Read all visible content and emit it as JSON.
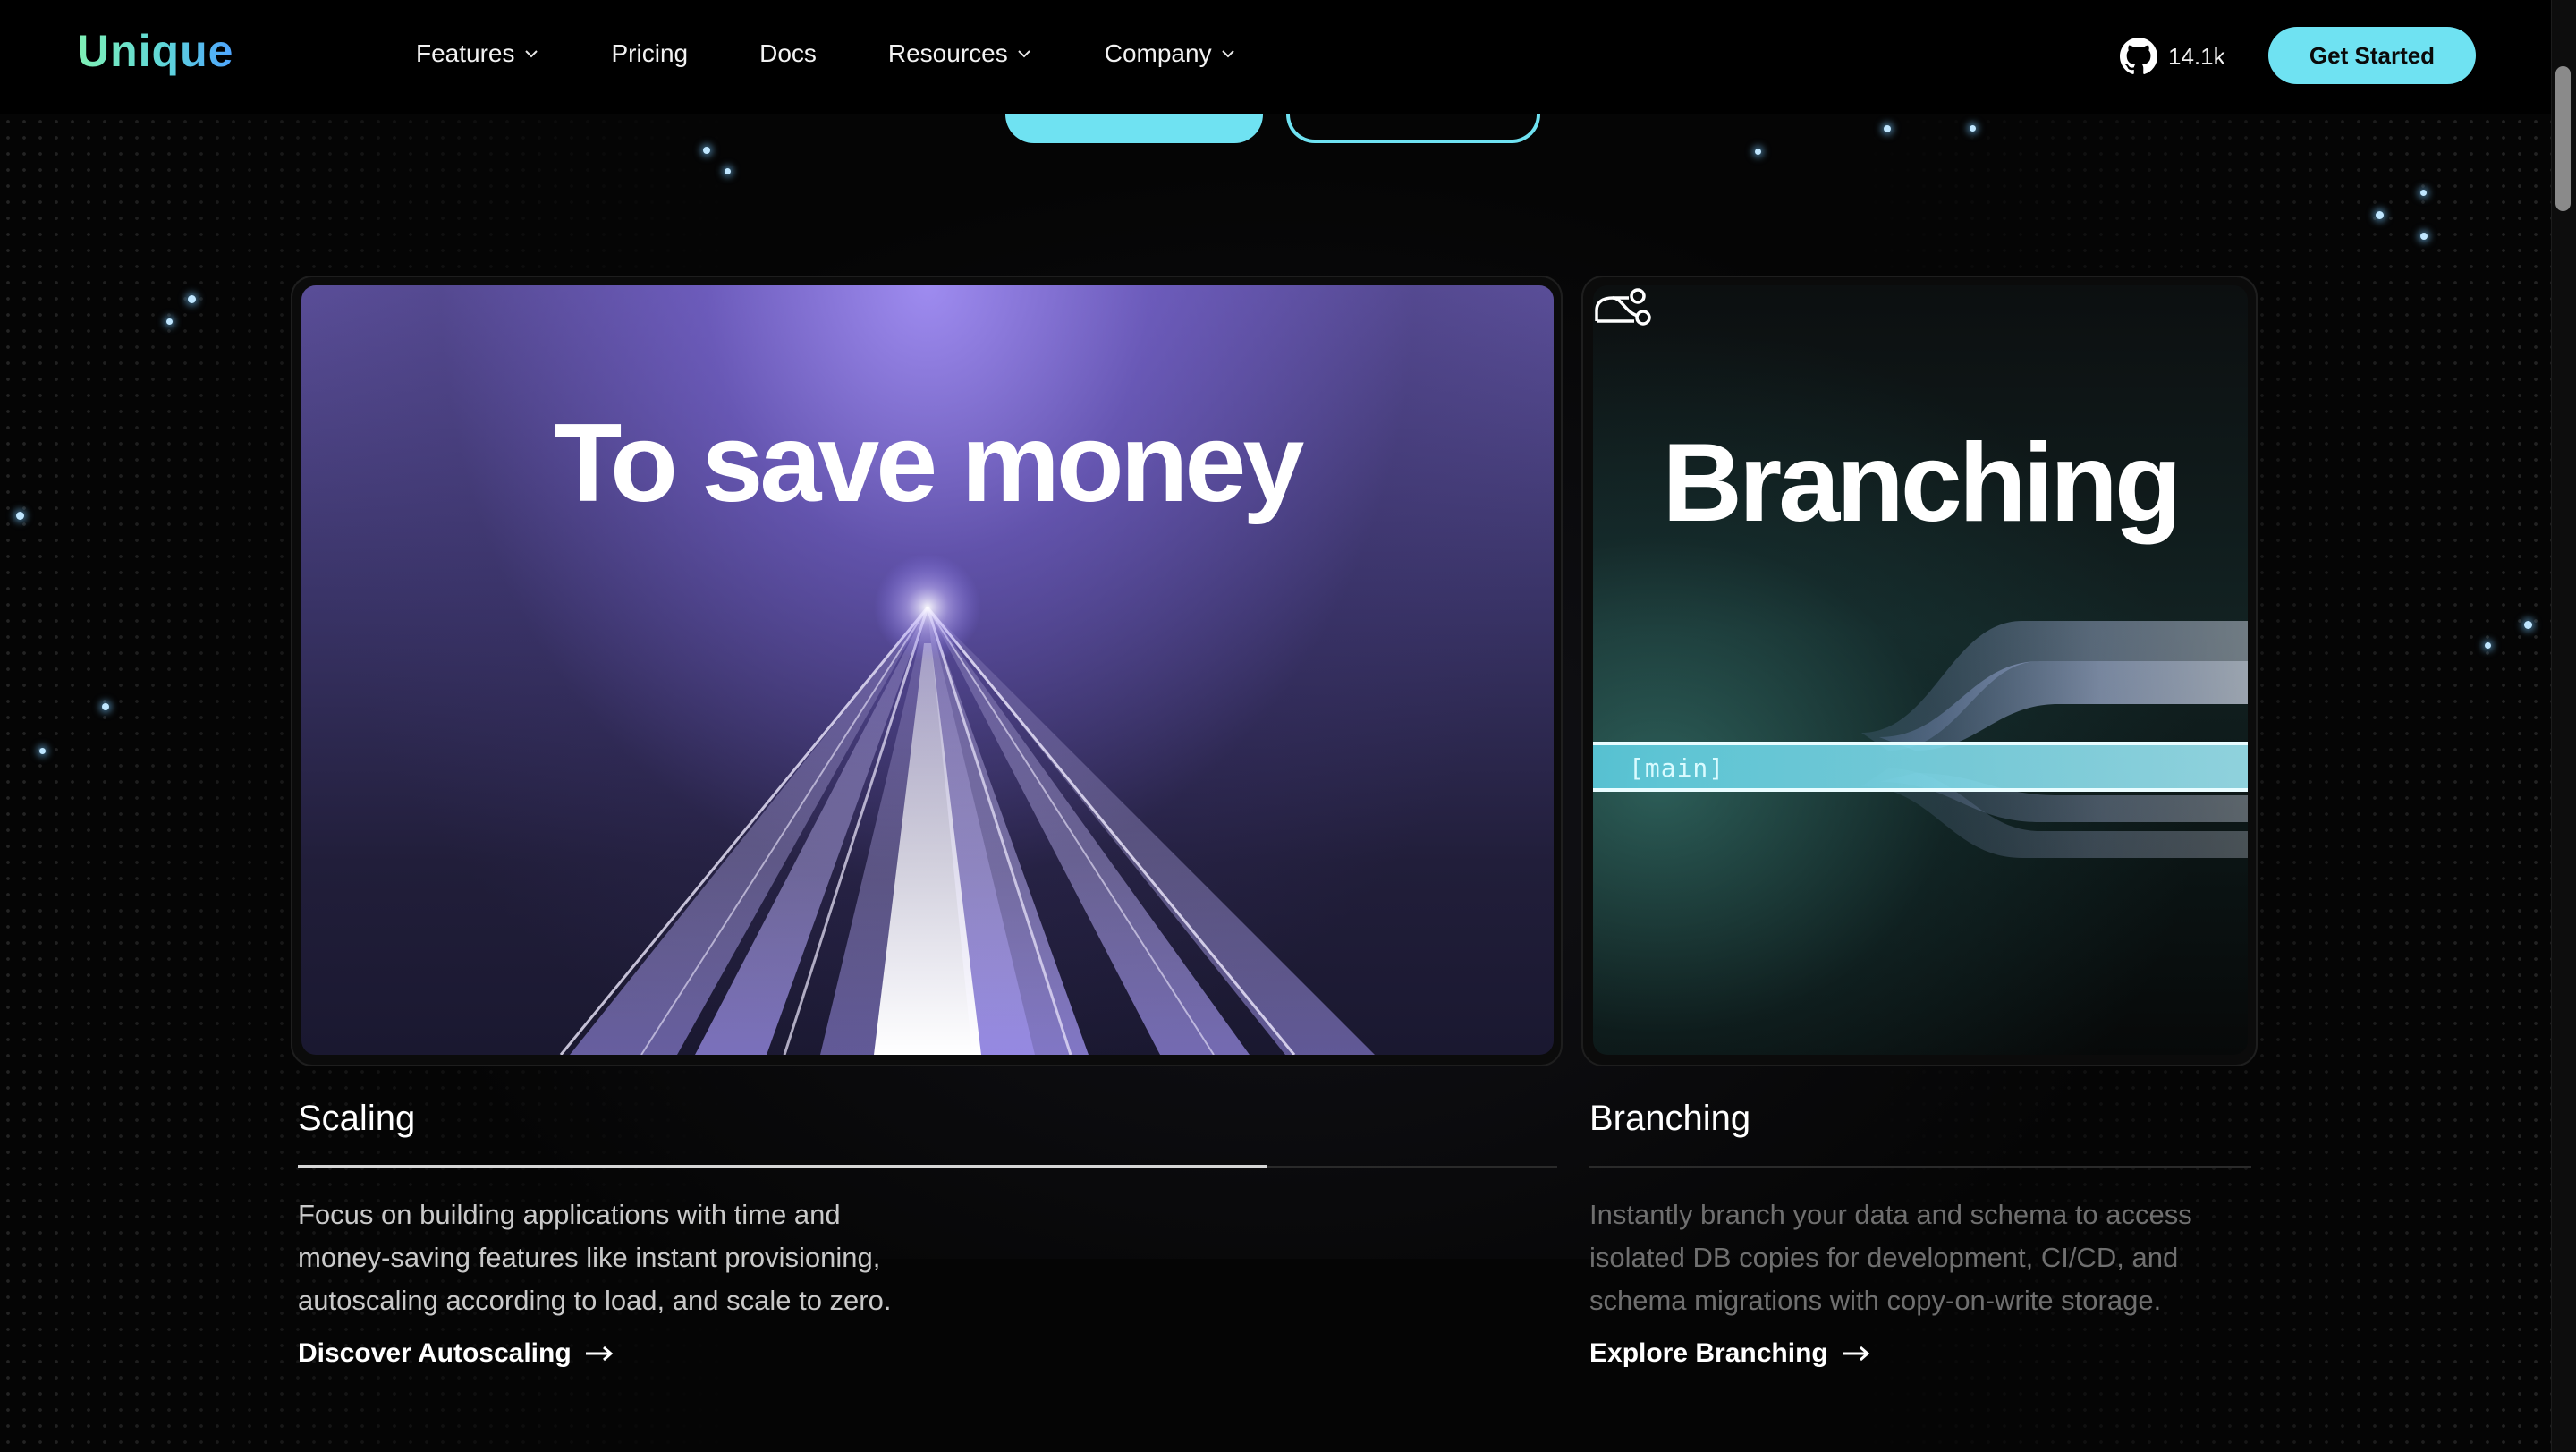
{
  "header": {
    "logo": "Unique",
    "nav": [
      {
        "label": "Features",
        "has_dropdown": true
      },
      {
        "label": "Pricing",
        "has_dropdown": false
      },
      {
        "label": "Docs",
        "has_dropdown": false
      },
      {
        "label": "Resources",
        "has_dropdown": true
      },
      {
        "label": "Company",
        "has_dropdown": true
      }
    ],
    "github_stars": "14.1k",
    "github_icon": "github-icon",
    "cta_label": "Get Started",
    "accent_color": "#6fe2f2"
  },
  "cards": {
    "scaling": {
      "banner_text": "To save money",
      "title": "Scaling",
      "progress": 0.77,
      "description": [
        "Focus on building applications with time and",
        "money-saving features like instant provisioning,",
        "autoscaling according to load, and scale to zero."
      ],
      "link_label": "Discover Autoscaling",
      "active": true
    },
    "branching": {
      "banner_text": "Branching",
      "branch_label": "[main]",
      "icon": "branch-icon",
      "title": "Branching",
      "description": [
        "Instantly branch your data and schema to access",
        "isolated DB copies for development, CI/CD, and",
        "schema migrations with copy-on-write storage."
      ],
      "link_label": "Explore Branching",
      "active": false
    }
  }
}
